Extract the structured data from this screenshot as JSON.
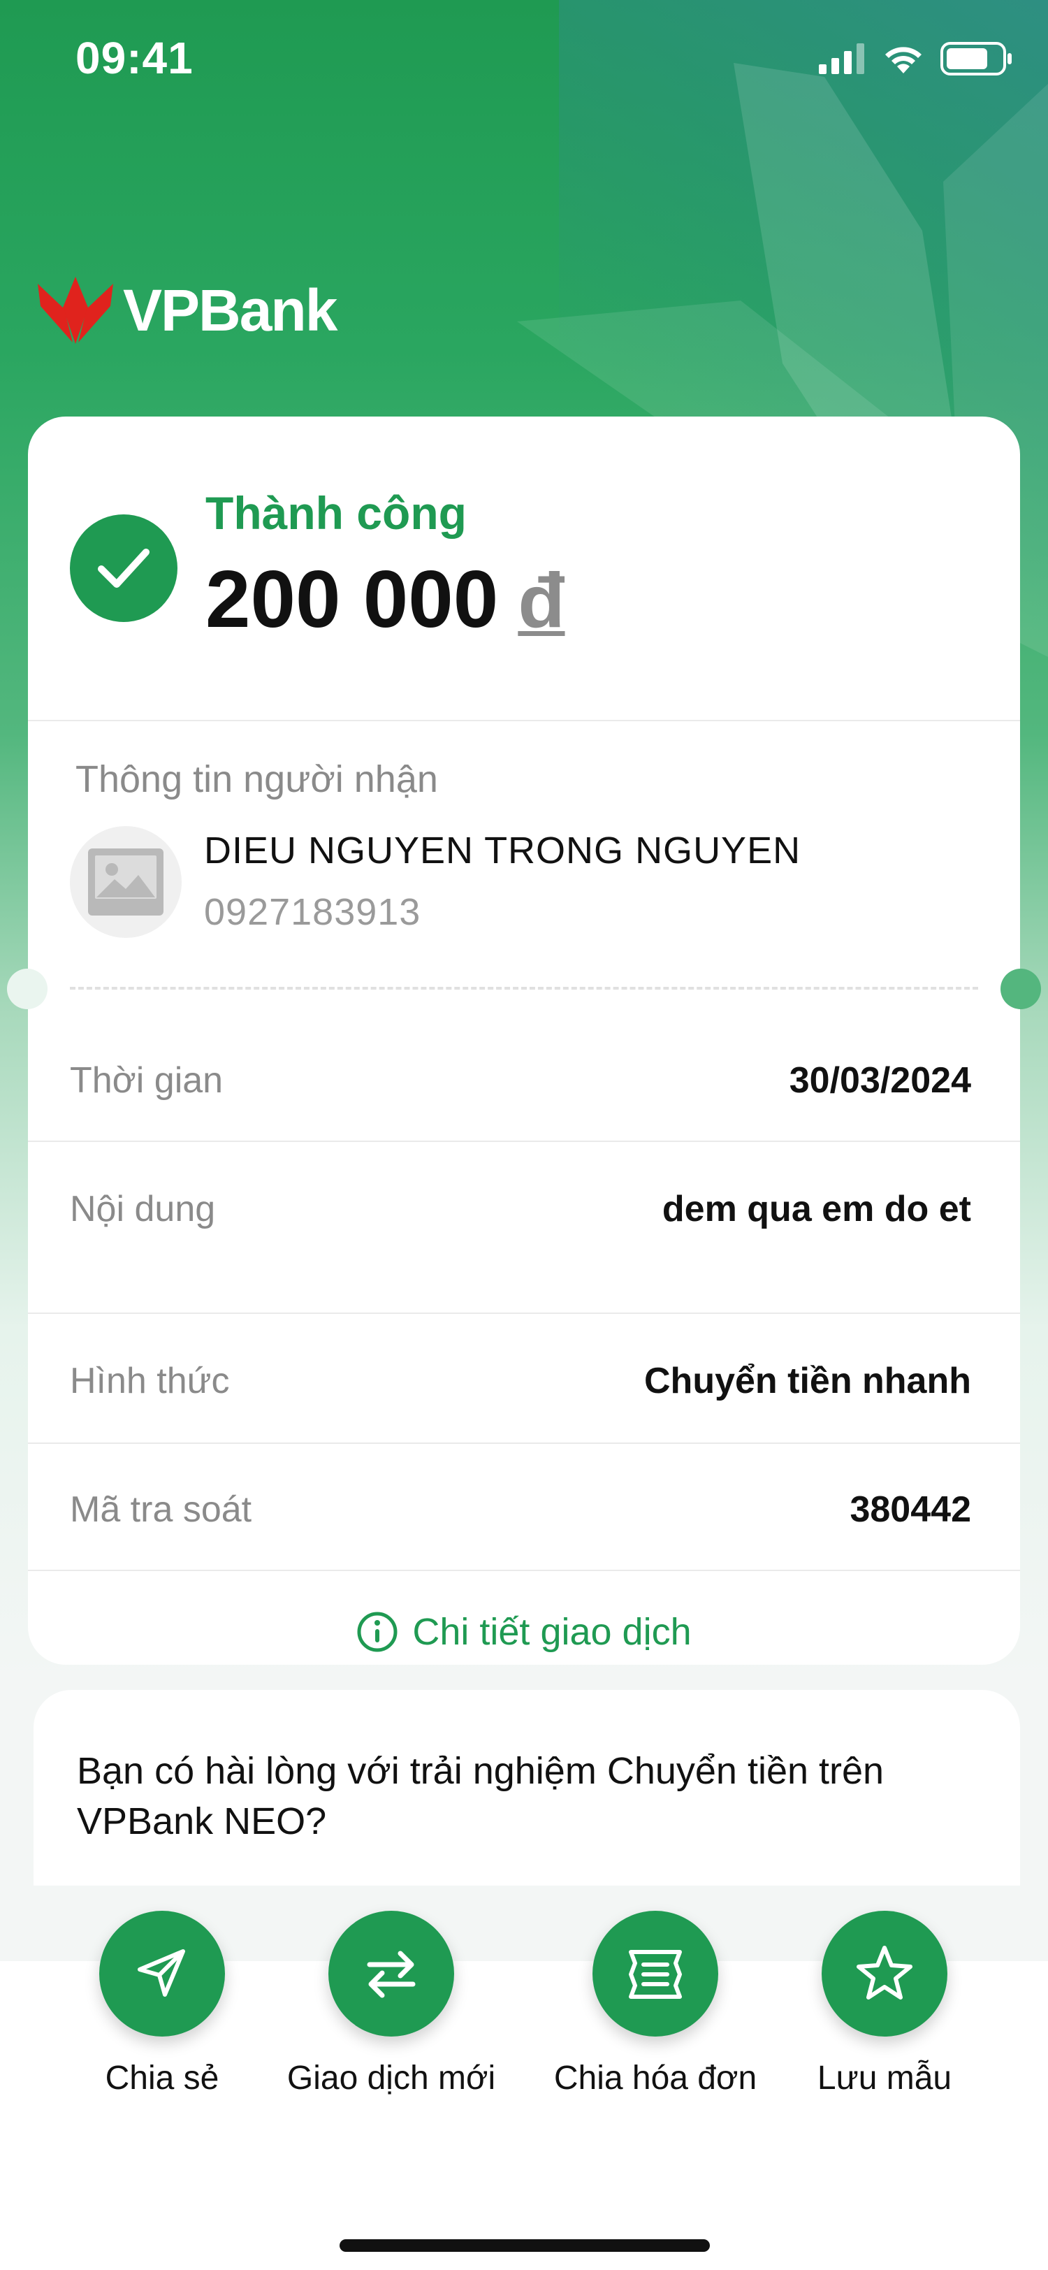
{
  "status_bar": {
    "time": "09:41"
  },
  "brand": {
    "name": "VPBank",
    "accent_color": "#1f9a52",
    "logo_color": "#e0231d"
  },
  "result": {
    "status": "Thành công",
    "amount": "200 000",
    "currency": "đ"
  },
  "recipient": {
    "heading": "Thông tin người nhận",
    "name": "DIEU NGUYEN TRONG NGUYEN",
    "phone": "0927183913"
  },
  "details": [
    {
      "label": "Thời gian",
      "value": "30/03/2024"
    },
    {
      "label": "Nội dung",
      "value": "dem qua em do et"
    },
    {
      "label": "Hình thức",
      "value": "Chuyển tiền nhanh"
    },
    {
      "label": "Mã tra soát",
      "value": "380442"
    }
  ],
  "detail_link": "Chi tiết giao dịch",
  "survey": {
    "question": "Bạn có hài lòng với trải nghiệm Chuyển tiền trên VPBank NEO?"
  },
  "actions": [
    {
      "label": "Chia sẻ",
      "icon": "send-icon"
    },
    {
      "label": "Giao dịch mới",
      "icon": "swap-arrows-icon"
    },
    {
      "label": "Chia hóa đơn",
      "icon": "receipt-icon"
    },
    {
      "label": "Lưu mẫu",
      "icon": "star-icon"
    }
  ]
}
